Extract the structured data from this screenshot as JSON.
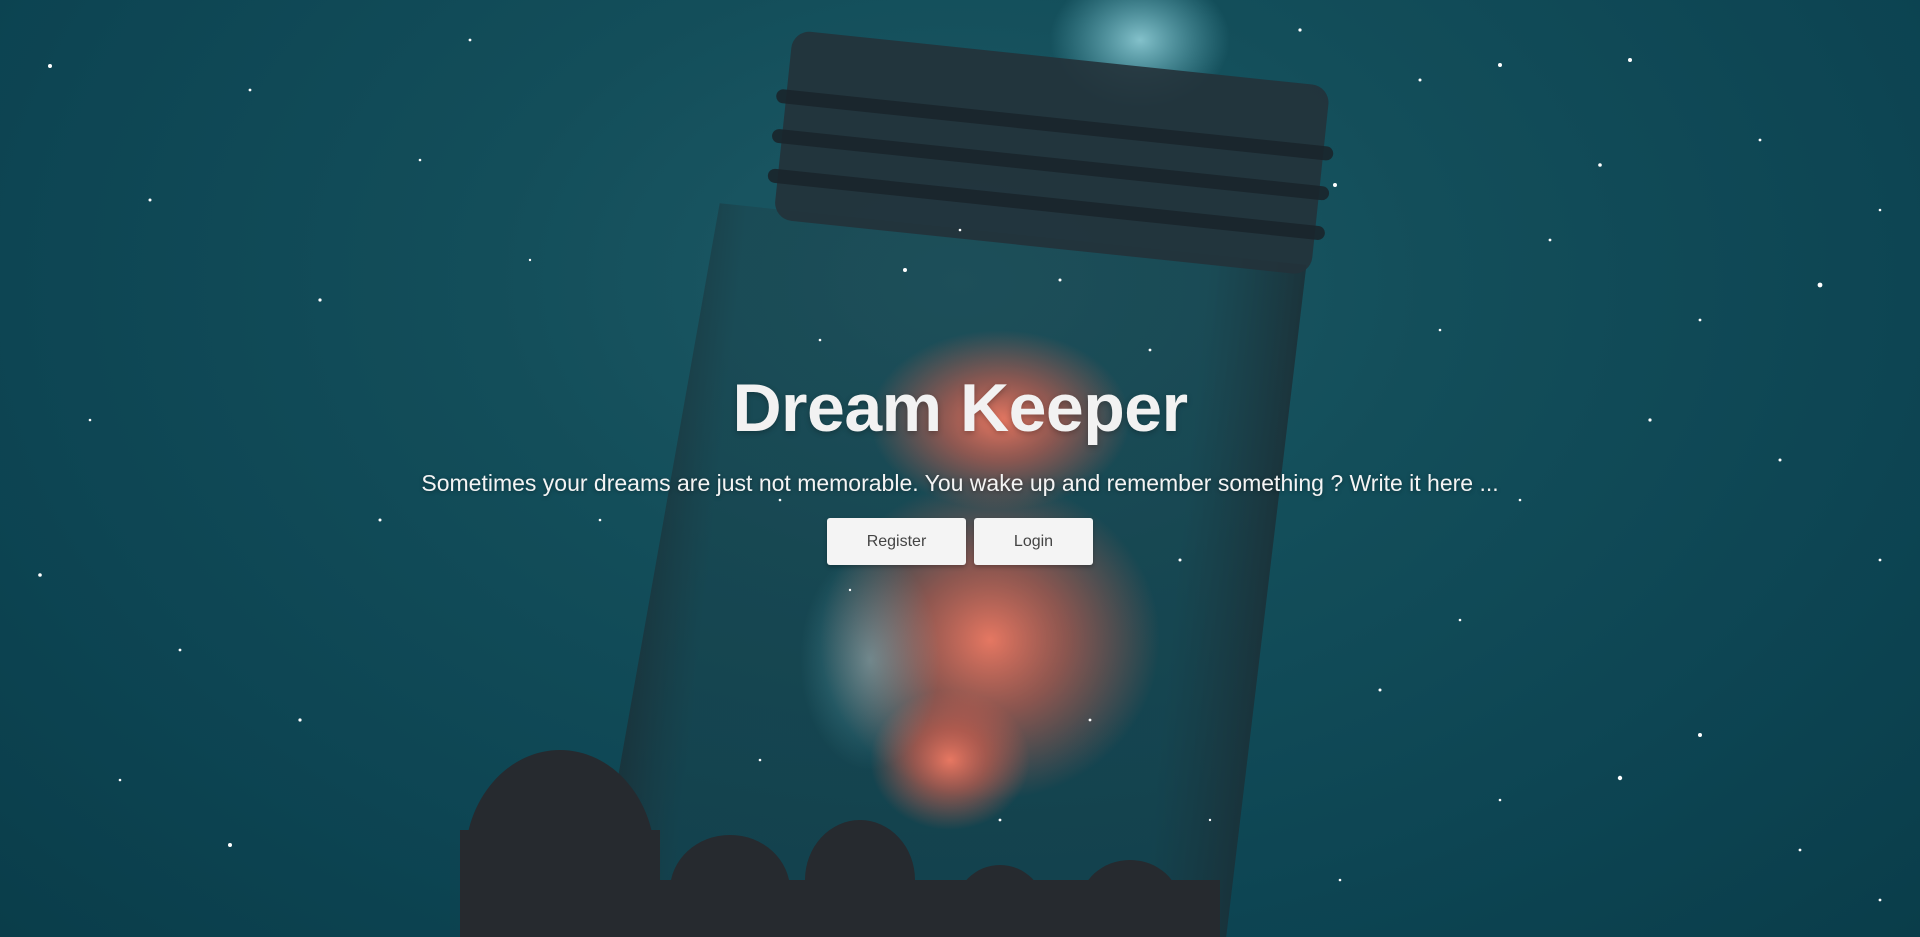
{
  "hero": {
    "title": "Dream Keeper",
    "subtitle": "Sometimes your dreams are just not memorable. You wake up and remember something ? Write it here ...",
    "background_image": "starry-night-jar-photo"
  },
  "actions": {
    "register_label": "Register",
    "login_label": "Login"
  },
  "colors": {
    "background": "#0d4553",
    "text": "#f2f2f2",
    "button_bg": "#f4f4f4",
    "button_text": "#444444",
    "nebula": "#e06a55"
  }
}
